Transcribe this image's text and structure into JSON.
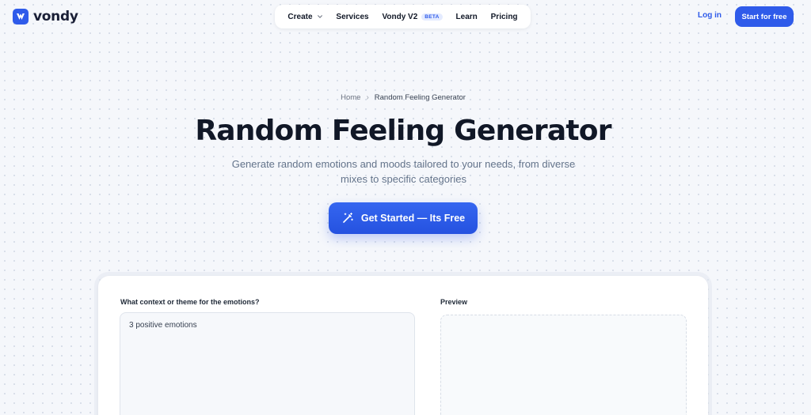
{
  "header": {
    "brand": "vondy",
    "nav": {
      "create": "Create",
      "services": "Services",
      "vondy_v2": "Vondy V2",
      "beta_badge": "BETA",
      "learn": "Learn",
      "pricing": "Pricing"
    },
    "login": "Log in",
    "start": "Start for free"
  },
  "breadcrumb": {
    "home": "Home",
    "separator": "›",
    "current": "Random Feeling Generator"
  },
  "hero": {
    "title": "Random Feeling Generator",
    "subtitle": "Generate random emotions and moods tailored to your needs, from diverse mixes to specific categories",
    "cta": "Get Started — Its Free"
  },
  "form": {
    "input_label": "What context or theme for the emotions?",
    "input_value": "3 positive emotions",
    "preview_label": "Preview"
  },
  "colors": {
    "accent": "#2f5bea",
    "page_bg": "#f5f7fb",
    "title": "#111827"
  },
  "icons": {
    "logo": "vondy-logo-icon",
    "create_dropdown": "chevron-down-icon",
    "cta": "magic-wand-icon"
  }
}
